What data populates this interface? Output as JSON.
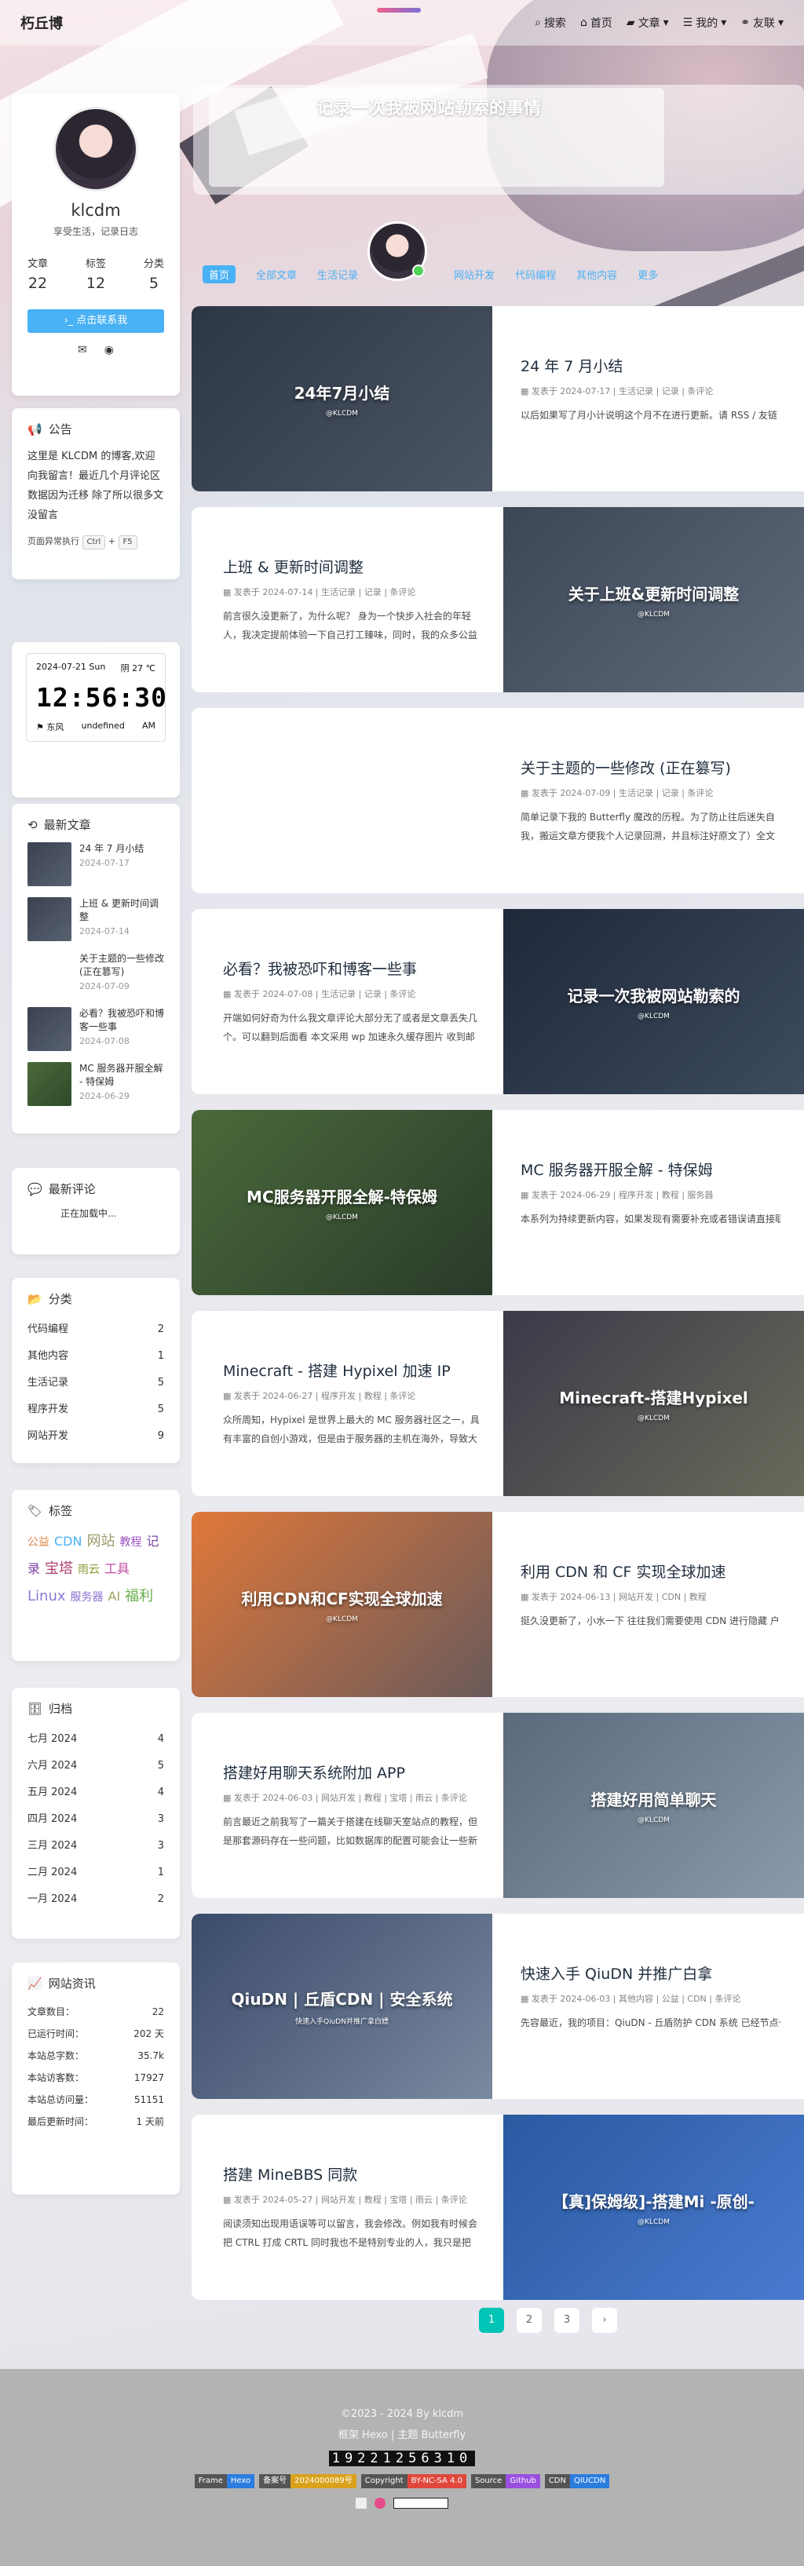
{
  "nav": {
    "brand": "朽丘博",
    "search": "搜索",
    "home": "首页",
    "articles": "文章",
    "mine": "我的",
    "friends": "友联"
  },
  "author": {
    "name": "klcdm",
    "desc": "享受生活，记录日志",
    "stats": [
      {
        "label": "文章",
        "value": "22"
      },
      {
        "label": "标签",
        "value": "12"
      },
      {
        "label": "分类",
        "value": "5"
      }
    ],
    "follow": "点击联系我"
  },
  "announcement": {
    "title": "公告",
    "text": "这里是 KLCDM 的博客,欢迎向我留言！最近几个月评论区数据因为迁移 除了所以很多文没留言",
    "hint": "页面异常执行",
    "key1": "Ctrl",
    "plus": "+",
    "key2": "F5"
  },
  "clock": {
    "date": "2024-07-21 Sun",
    "weather": "阴 27 ℃",
    "time": "12:56:30",
    "wind": "东风",
    "undefined": "undefined",
    "ampm": "AM"
  },
  "recent": {
    "title": "最新文章",
    "items": [
      {
        "title": "24 年 7 月小结",
        "date": "2024-07-17"
      },
      {
        "title": "上班 & 更新时间调整",
        "date": "2024-07-14"
      },
      {
        "title": "关于主题的一些修改 (正在篡写)",
        "date": "2024-07-09"
      },
      {
        "title": "必看？我被恐吓和博客一些事",
        "date": "2024-07-08"
      },
      {
        "title": "MC 服务器开服全解 - 特保姆",
        "date": "2024-06-29"
      }
    ]
  },
  "comments": {
    "title": "最新评论",
    "loading": "正在加载中..."
  },
  "categories": {
    "title": "分类",
    "items": [
      {
        "name": "代码编程",
        "count": "2"
      },
      {
        "name": "其他内容",
        "count": "1"
      },
      {
        "name": "生活记录",
        "count": "5"
      },
      {
        "name": "程序开发",
        "count": "5"
      },
      {
        "name": "网站开发",
        "count": "9"
      }
    ]
  },
  "tags": {
    "title": "标签",
    "items": [
      {
        "name": "公益",
        "color": "#e0884a"
      },
      {
        "name": "CDN",
        "color": "#49b1f5"
      },
      {
        "name": "网站",
        "color": "#9a9a6a"
      },
      {
        "name": "教程",
        "color": "#9c4fc0"
      },
      {
        "name": "记录",
        "color": "#7a43a6"
      },
      {
        "name": "宝塔",
        "color": "#b04070"
      },
      {
        "name": "雨云",
        "color": "#8a9c30"
      },
      {
        "name": "工具",
        "color": "#c04aa0"
      },
      {
        "name": "Linux",
        "color": "#8a7ad6"
      },
      {
        "name": "服务器",
        "color": "#8a6fd0"
      },
      {
        "name": "AI",
        "color": "#a0a060"
      },
      {
        "name": "福利",
        "color": "#6ab04a"
      }
    ]
  },
  "archives": {
    "title": "归档",
    "items": [
      {
        "name": "七月 2024",
        "count": "4"
      },
      {
        "name": "六月 2024",
        "count": "5"
      },
      {
        "name": "五月 2024",
        "count": "4"
      },
      {
        "name": "四月 2024",
        "count": "3"
      },
      {
        "name": "三月 2024",
        "count": "3"
      },
      {
        "name": "二月 2024",
        "count": "1"
      },
      {
        "name": "一月 2024",
        "count": "2"
      }
    ]
  },
  "webinfo": {
    "title": "网站资讯",
    "items": [
      {
        "name": "文章数目：",
        "value": "22"
      },
      {
        "name": "已运行时间：",
        "value": "202 天"
      },
      {
        "name": "本站总字数：",
        "value": "35.7k"
      },
      {
        "name": "本站访客数：",
        "value": "17927"
      },
      {
        "name": "本站总访问量：",
        "value": "51151"
      },
      {
        "name": "最后更新时间：",
        "value": "1 天前"
      }
    ]
  },
  "hero": {
    "title": "记录一次我被网站勒索的事情"
  },
  "catbar": {
    "items": [
      "首页",
      "全部文章",
      "生活记录",
      "网站开发",
      "代码编程",
      "其他内容",
      "更多"
    ]
  },
  "posts": [
    {
      "title": "24 年 7 月小结",
      "cover": "24年7月小结",
      "cover_sub": "@KLCDM",
      "meta": "发表于 2024-07-17 | 生活记录 | 记录 | 条评论",
      "excerpt": "以后如果写了月小计说明这个月不在进行更新。请 RSS / 友链 看到我写了小结可以接下来这个月内不用互访避免了不必要的"
    },
    {
      "title": "上班 & 更新时间调整",
      "cover": "关于上班&更新时间调整",
      "cover_sub": "@KLCDM",
      "meta": "发表于 2024-07-14 | 生活记录 | 记录 | 条评论",
      "excerpt": "前言很久没更新了，为什么呢？ 身为一个快步入社会的年轻人，我决定提前体验一下自己打工臻味，同时，我的众多公益项目，因为急缺资..."
    },
    {
      "title": "关于主题的一些修改 (正在篡写)",
      "cover": "",
      "cover_sub": "",
      "meta": "发表于 2024-07-09 | 生活记录 | 记录 | 条评论",
      "excerpt": "简单记录下我的 Butterfly 魔改的历程。为了防止往后迷失自我，搬运文章方便我个人记录回溯，并且标注好原文了）全文未提..."
    },
    {
      "title": "必看？我被恐吓和博客一些事",
      "cover": "记录一次我被网站勒索的",
      "cover_sub": "@KLCDM",
      "meta": "发表于 2024-07-08 | 生活记录 | 记录 | 条评论",
      "excerpt": "开端如何好奇为什么我文章评论大部分无了或者是文章丢失几个。可以翻到后面看 本文采用 wp 加速永久缓存图片 收到邮件在一次忙碌的打..."
    },
    {
      "title": "MC 服务器开服全解 - 特保姆",
      "cover": "MC服务器开服全解-特保姆",
      "cover_sub": "@KLCDM",
      "meta": "发表于 2024-06-29 | 程序开发 | 教程 | 服务器",
      "excerpt": "本系列为持续更新内容，如果发现有需要补充或者错误请直接联系我 台都会进行更新修复内容 本文基于 雨云 - 新一代云服务提供商"
    },
    {
      "title": "Minecraft - 搭建 Hypixel 加速 IP",
      "cover": "Minecraft-搭建Hypixel",
      "cover_sub": "@KLCDM",
      "meta": "发表于 2024-06-27 | 程序开发 | 教程 | 条评论",
      "excerpt": "众所周知，Hypixel 是世界上最大的 MC 服务器社区之一，具有丰富的自创小游戏，但是由于服务器的主机在海外，导致大陆裸连 1000ms+ 都..."
    },
    {
      "title": "利用 CDN 和 CF 实现全球加速",
      "cover": "利用CDN和CF实现全球加速",
      "cover_sub": "@KLCDM",
      "meta": "发表于 2024-06-13 | 网站开发 | CDN | 教程",
      "excerpt": "挺久没更新了，小水一下 往往我们需要使用 CDN 进行隐藏 户，但是很多 CDN 是对标一个地区进行优化，例如亚太 CF"
    },
    {
      "title": "搭建好用聊天系统附加 APP",
      "cover": "搭建好用简单聊天",
      "cover_sub": "@KLCDM",
      "meta": "发表于 2024-06-03 | 网站开发 | 教程 | 宝塔 | 雨云 | 条评论",
      "excerpt": "前言最近之前我写了一篇关于搭建在线聊天室站点的教程，但是那套源码存在一些问题，比如数据库的配置可能会让一些新手遇到困难。整体..."
    },
    {
      "title": "快速入手 QiuDN 并推广白拿",
      "cover": "QiuDN | 丘盾CDN | 安全系统",
      "cover_sub": "快速入手QiuDN并推广拿白嫖",
      "meta": "发表于 2024-06-03 | 其他内容 | 公益 | CDN | 条评论",
      "excerpt": "先容最近，我的项目：QiuDN - 丘盾防护 CDN 系统 已经节点也上满，开启了付费模式试运营，虽然添加了付费模式"
    },
    {
      "title": "搭建 MineBBS 同款",
      "cover": "【真]保姆级]-搭建Mi -原创-",
      "cover_sub": "@KLCDM",
      "meta": "发表于 2024-05-27 | 网站开发 | 教程 | 宝塔 | 雨云 | 条评论",
      "excerpt": "阅读须知出现用语误等可以留言，我会修改。例如我有时候会把 CTRL 打成 CRTL 同时我也不是特别专业的人，我只是把自己的经历写了出来..."
    }
  ],
  "pager": {
    "p1": "1",
    "p2": "2",
    "p3": "3",
    "next": "›"
  },
  "footer": {
    "copyright": "©2023 - 2024 By klcdm",
    "theme": "框架 Hexo | 主题 Butterfly",
    "counter": "19221256310",
    "badges": [
      {
        "k": "Frame",
        "v": "Hexo",
        "c": "#2b7de0"
      },
      {
        "k": "备案号",
        "v": "2024000089号",
        "c": "#d9a11c"
      },
      {
        "k": "Copyright",
        "v": "BY-NC-SA 4.0",
        "c": "#e0483c"
      },
      {
        "k": "Source",
        "v": "Github",
        "c": "#9a4fe0"
      },
      {
        "k": "CDN",
        "v": "QIUCDN",
        "c": "#2b7de0"
      }
    ]
  }
}
